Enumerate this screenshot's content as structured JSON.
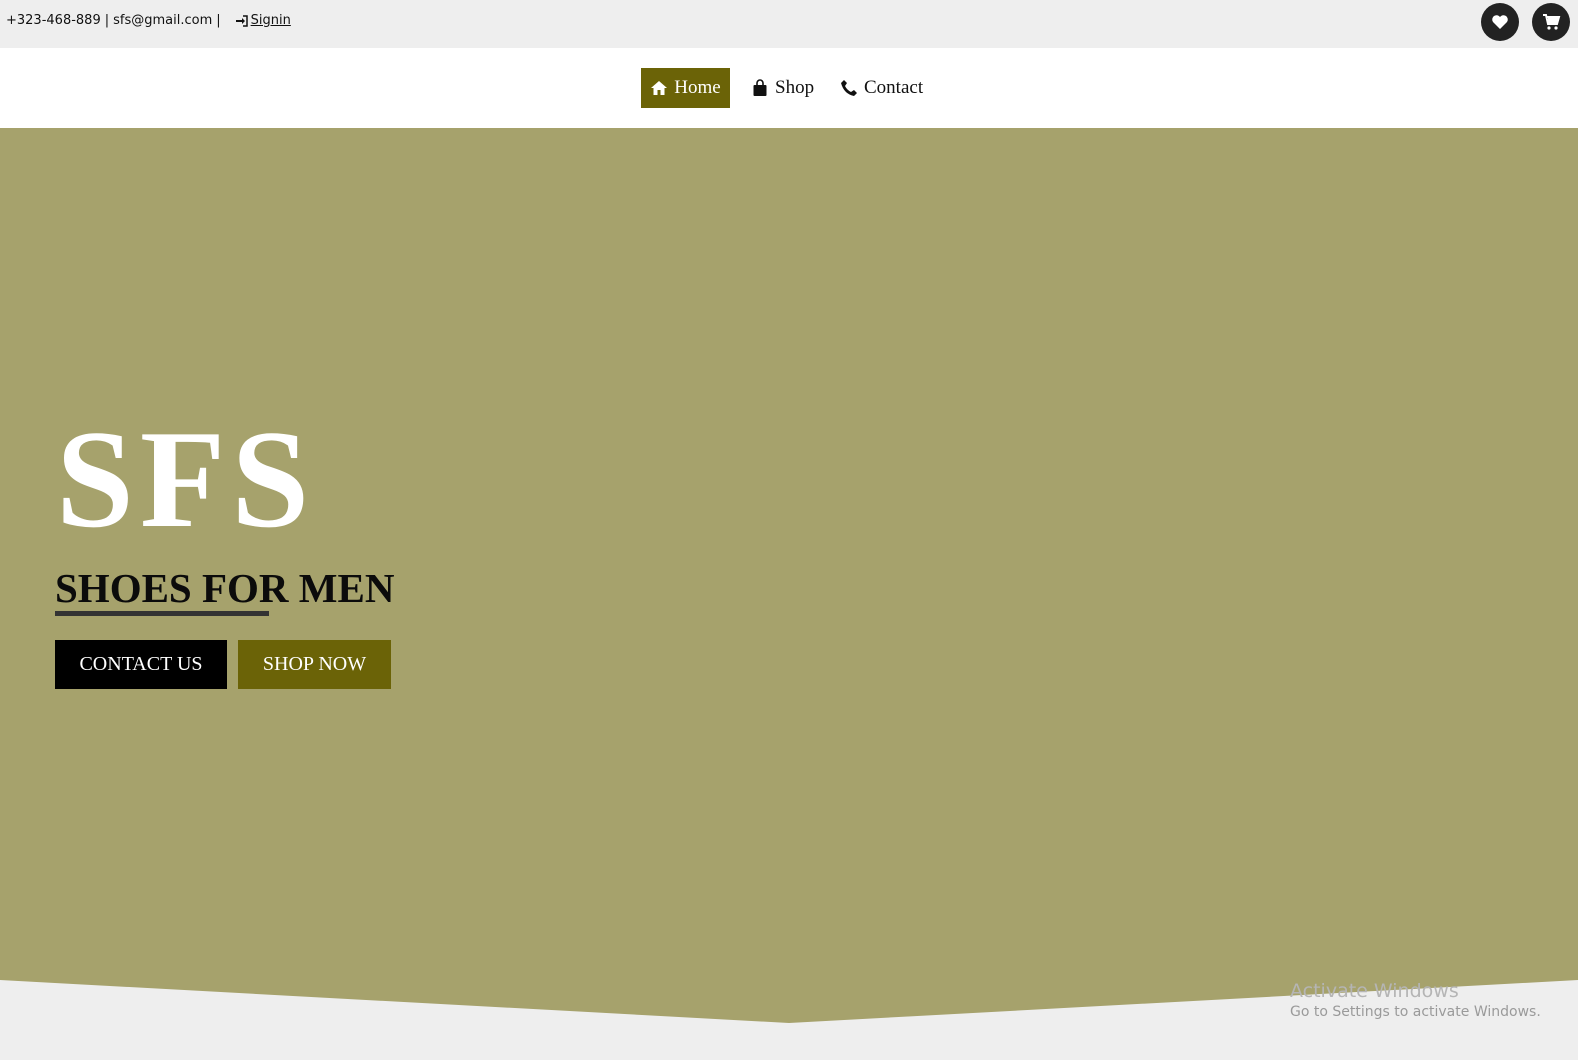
{
  "topbar": {
    "phone": "+323-468-889",
    "separator": "|",
    "email": "sfs@gmail.com",
    "signin_label": "Signin"
  },
  "nav": {
    "home": "Home",
    "shop": "Shop",
    "contact": "Contact"
  },
  "hero": {
    "brand": "SFS",
    "tagline": "SHOES FOR MEN",
    "contact_button": "CONTACT US",
    "shop_button": "SHOP NOW"
  },
  "watermark": {
    "title": "Activate Windows",
    "subtitle": "Go to Settings to activate Windows."
  },
  "colors": {
    "hero_bg": "#a6a26c",
    "accent": "#6b6307",
    "topbar_bg": "#eeeeee"
  },
  "icons": {
    "signin": "sign-in-icon",
    "wishlist": "heart-icon",
    "cart": "cart-icon",
    "home": "home-icon",
    "shop": "shopping-bag-icon",
    "contact": "phone-icon"
  }
}
